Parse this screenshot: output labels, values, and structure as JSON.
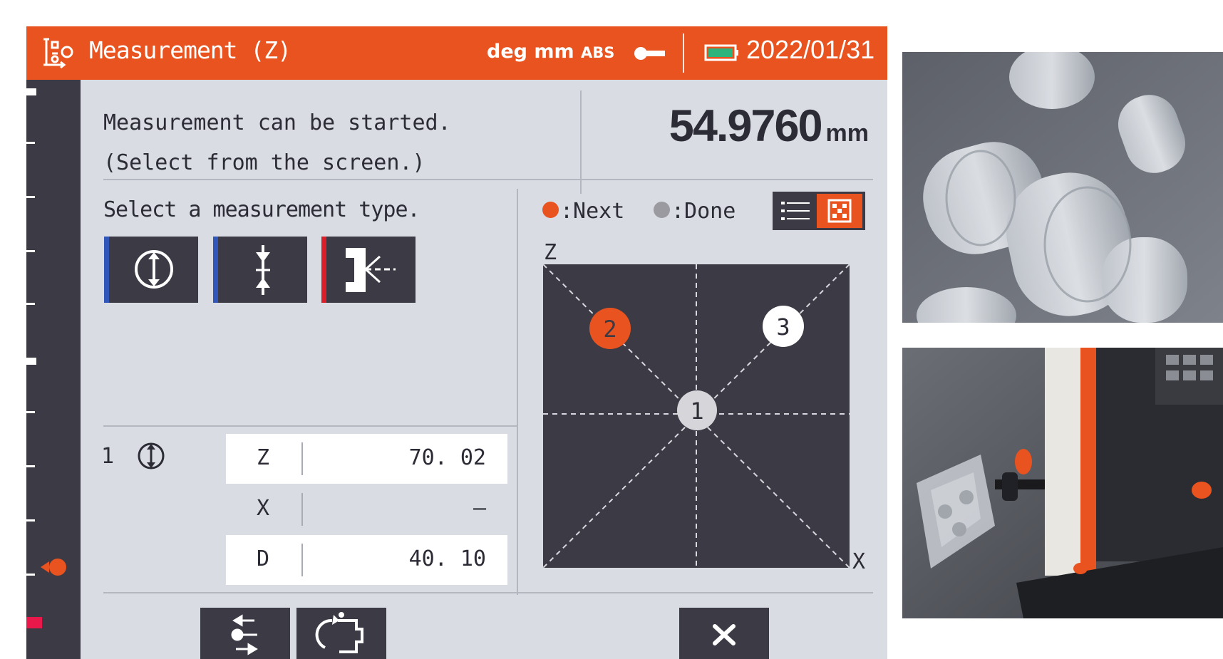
{
  "header": {
    "title": "Measurement (Z)",
    "units": "deg  mm",
    "mode": "ABS",
    "date": "2022/01/31"
  },
  "status": {
    "line1": "Measurement can be started.",
    "line2": "(Select from the screen.)"
  },
  "reading": {
    "value": "54.9760",
    "unit": "mm"
  },
  "type_prompt": "Select a measurement type.",
  "measurement_types": [
    {
      "icon": "circle-updown-icon",
      "stripe_color": "#2f56b8"
    },
    {
      "icon": "point-width-icon",
      "stripe_color": "#2f56b8"
    },
    {
      "icon": "probe-edge-icon",
      "stripe_color": "#d91f2a"
    }
  ],
  "legend": {
    "next": ":Next",
    "done": ":Done",
    "next_color": "#e8531f",
    "done_color": "#9a9aa0"
  },
  "diagram": {
    "z_label": "Z",
    "x_label": "X",
    "points": [
      {
        "label": "1",
        "state": "done"
      },
      {
        "label": "2",
        "state": "next"
      },
      {
        "label": "3",
        "state": "pending"
      }
    ]
  },
  "result": {
    "index": "1",
    "fields": [
      {
        "label": "Z",
        "value": "70. 02"
      },
      {
        "label": "X",
        "value": "–"
      },
      {
        "label": "D",
        "value": "40. 10"
      }
    ]
  },
  "colors": {
    "accent": "#e8531f",
    "panel": "#dadce3",
    "dark": "#3b3a45"
  }
}
